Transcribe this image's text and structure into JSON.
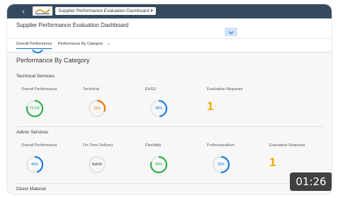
{
  "shell": {
    "back_icon_glyph": "‹",
    "app_title": "Supplier Performance Evaluation Dashboard",
    "dropdown_icon_glyph": "▾"
  },
  "header": {
    "page_title": "Supplier Performance Evaluation Dashboard",
    "collapse_icon_glyph": "⌄"
  },
  "tabs": [
    {
      "label": "Overall Performance",
      "active": true
    },
    {
      "label": "Performance By Category",
      "dropdown_glyph": "⌄",
      "active": false
    }
  ],
  "section": {
    "heading": "Performance By Category"
  },
  "groups": [
    {
      "title": "Technical Services",
      "kpis": [
        {
          "label": "Overall Performance",
          "value_text": "79.5%",
          "fraction": 0.795,
          "color": "#2db14a"
        },
        {
          "label": "Technical",
          "value_text": "31%",
          "fraction": 0.31,
          "color": "#e9730c"
        },
        {
          "label": "EHSS",
          "value_text": "48%",
          "fraction": 0.48,
          "color": "#1b7de0"
        },
        {
          "label": "Evaluation Requests",
          "value_text": "1",
          "color": "#f0ab00"
        }
      ]
    },
    {
      "title": "Admin Services",
      "kpis": [
        {
          "label": "Overall Performance",
          "value_text": "45%",
          "fraction": 0.45,
          "color": "#1b7de0"
        },
        {
          "label": "On-Time Delivery",
          "value_text": "NaN%",
          "fraction": 0,
          "color": "#9a9a9a"
        },
        {
          "label": "Flexibility",
          "value_text": "80%",
          "fraction": 0.8,
          "color": "#2db14a"
        },
        {
          "label": "Professionalism",
          "value_text": "50%",
          "fraction": 0.5,
          "color": "#1b7de0"
        },
        {
          "label": "Evaluation Requests",
          "value_text": "1",
          "color": "#f0ab00"
        }
      ]
    },
    {
      "title": "Direct Material"
    }
  ],
  "overlay": {
    "video_timestamp": "01:26"
  },
  "colors": {
    "shell_bar": "#354a5f",
    "accent": "#0a6ed1",
    "ring_track": "#e5e5e5",
    "evaluation_number": "#f0ab00"
  }
}
